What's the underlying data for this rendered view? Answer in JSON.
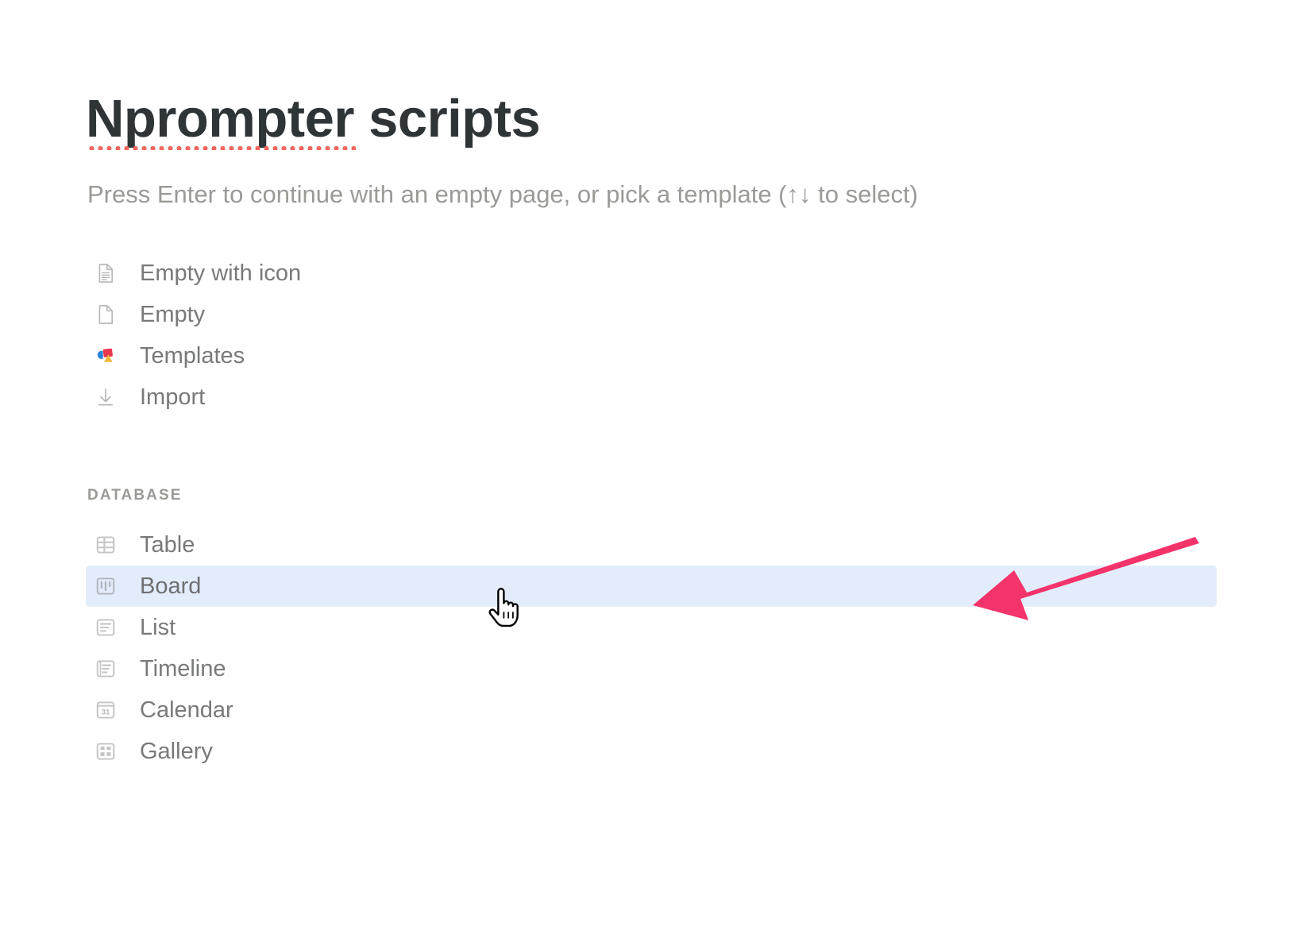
{
  "page": {
    "title_misspelled_part": "Nprompter",
    "title_rest": " scripts",
    "subtitle": "Press Enter to continue with an empty page, or pick a template (↑↓ to select)",
    "background_color": "#ffffff",
    "title_color": "#2f3437",
    "muted_text_color": "#9b9a97"
  },
  "menu": {
    "items": [
      {
        "label": "Empty with icon",
        "icon": "document-lines-icon"
      },
      {
        "label": "Empty",
        "icon": "document-blank-icon"
      },
      {
        "label": "Templates",
        "icon": "templates-shapes-icon"
      },
      {
        "label": "Import",
        "icon": "import-download-arrow-icon"
      }
    ]
  },
  "database_section": {
    "header": "DATABASE",
    "items": [
      {
        "label": "Table",
        "icon": "table-grid-icon",
        "selected": false
      },
      {
        "label": "Board",
        "icon": "board-kanban-icon",
        "selected": true
      },
      {
        "label": "List",
        "icon": "list-lines-icon",
        "selected": false
      },
      {
        "label": "Timeline",
        "icon": "timeline-icon",
        "selected": false
      },
      {
        "label": "Calendar",
        "icon": "calendar-31-icon",
        "selected": false
      },
      {
        "label": "Gallery",
        "icon": "gallery-cards-icon",
        "selected": false
      }
    ],
    "calendar_icon_day": "31",
    "selected_row_color": "#e3ecfa"
  },
  "annotations": {
    "arrow_color": "#f4336b",
    "arrow_points_to": "Board",
    "cursor_type": "pointing-hand"
  },
  "spellcheck": {
    "underline_color": "#f2685e",
    "word": "Nprompter"
  }
}
